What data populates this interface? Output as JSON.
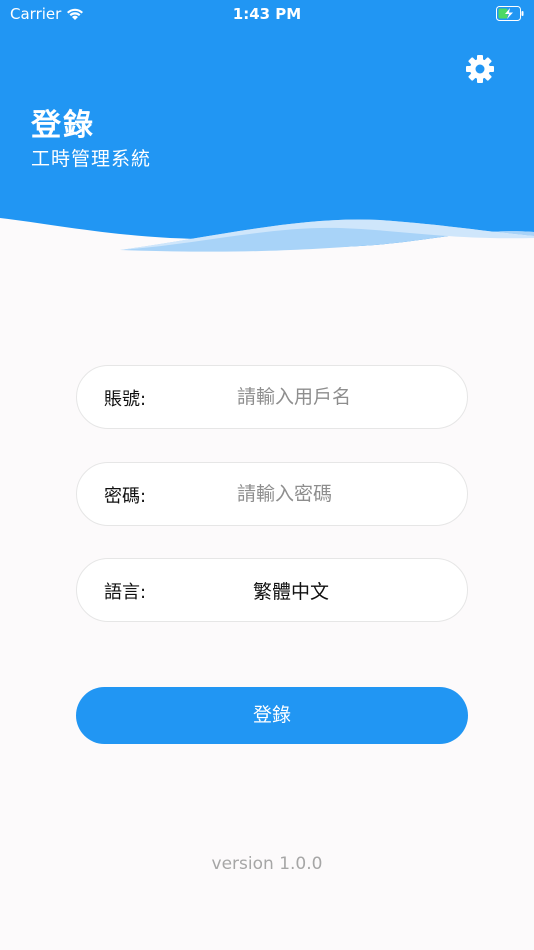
{
  "status_bar": {
    "carrier": "Carrier",
    "time": "1:43 PM"
  },
  "header": {
    "title": "登錄",
    "subtitle": "工時管理系統",
    "settings_icon": "gear-icon"
  },
  "form": {
    "account": {
      "label": "賬號:",
      "placeholder": "請輸入用戶名",
      "value": ""
    },
    "password": {
      "label": "密碼:",
      "placeholder": "請輸入密碼",
      "value": ""
    },
    "language": {
      "label": "語言:",
      "selected": "繁體中文"
    }
  },
  "login_button": "登錄",
  "footer": {
    "version": "version 1.0.0"
  },
  "colors": {
    "primary": "#2196f3",
    "background": "#fcfafb",
    "placeholder": "#8e8e8e",
    "version_text": "#a6a6a6"
  }
}
